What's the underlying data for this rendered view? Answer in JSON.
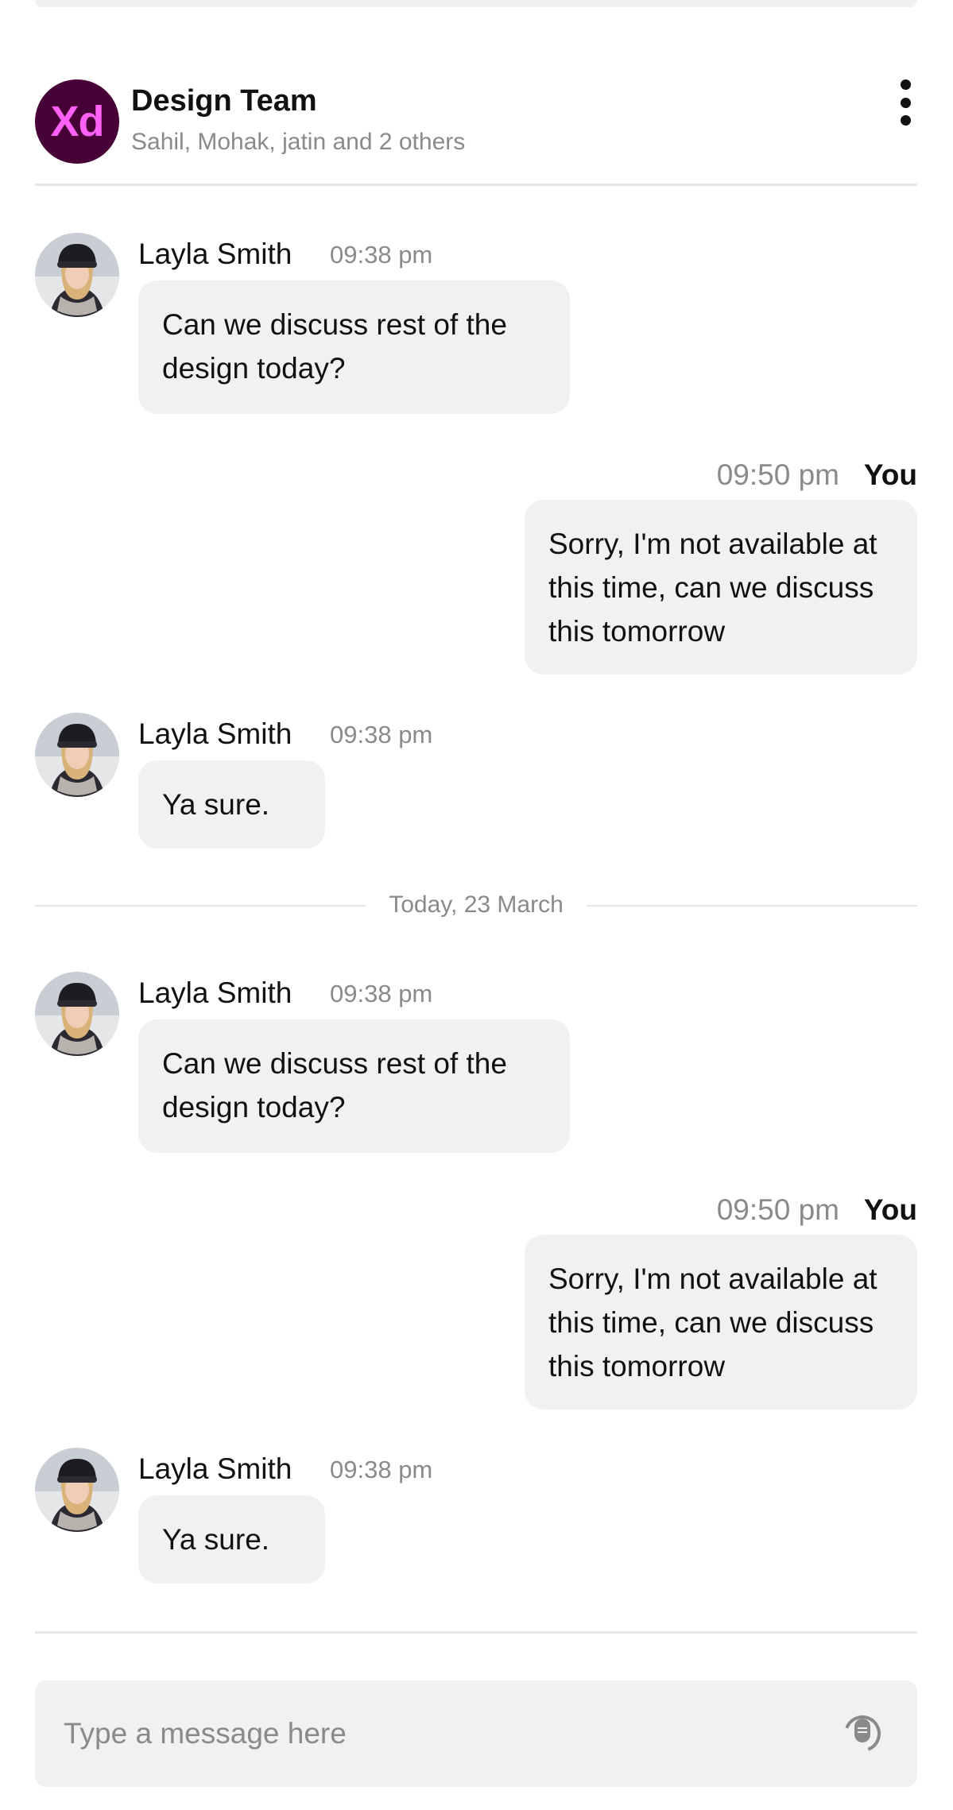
{
  "header": {
    "logo_text": "Xd",
    "group_name": "Design Team",
    "members": "Sahil, Mohak, jatin and 2 others"
  },
  "messages": [
    {
      "sender": "Layla Smith",
      "time": "09:38 pm",
      "lines": [
        "Can we discuss rest of the",
        "design today?"
      ]
    },
    {
      "sender": "You",
      "time": "09:50 pm",
      "lines": [
        "Sorry, I'm not available at",
        "this time, can we discuss",
        "this tomorrow"
      ]
    },
    {
      "sender": "Layla Smith",
      "time": "09:38 pm",
      "lines": [
        "Ya sure."
      ]
    },
    {
      "sender": "Layla Smith",
      "time": "09:38 pm",
      "lines": [
        "Can we discuss rest of the",
        "design today?"
      ]
    },
    {
      "sender": "You",
      "time": "09:50 pm",
      "lines": [
        "Sorry, I'm not available at",
        "this time, can we discuss",
        "this tomorrow"
      ]
    },
    {
      "sender": "Layla Smith",
      "time": "09:38 pm",
      "lines": [
        "Ya sure."
      ]
    }
  ],
  "date_separator": "Today, 23 March",
  "composer": {
    "placeholder": "Type a message here",
    "value": ""
  },
  "icons": {
    "menu": "more-vertical-icon",
    "mic": "microphone-icon"
  },
  "colors": {
    "logo_bg": "#470137",
    "logo_text": "#ff61f6",
    "bubble_bg": "#f1f1f1",
    "muted_text": "#8a8a8a"
  }
}
